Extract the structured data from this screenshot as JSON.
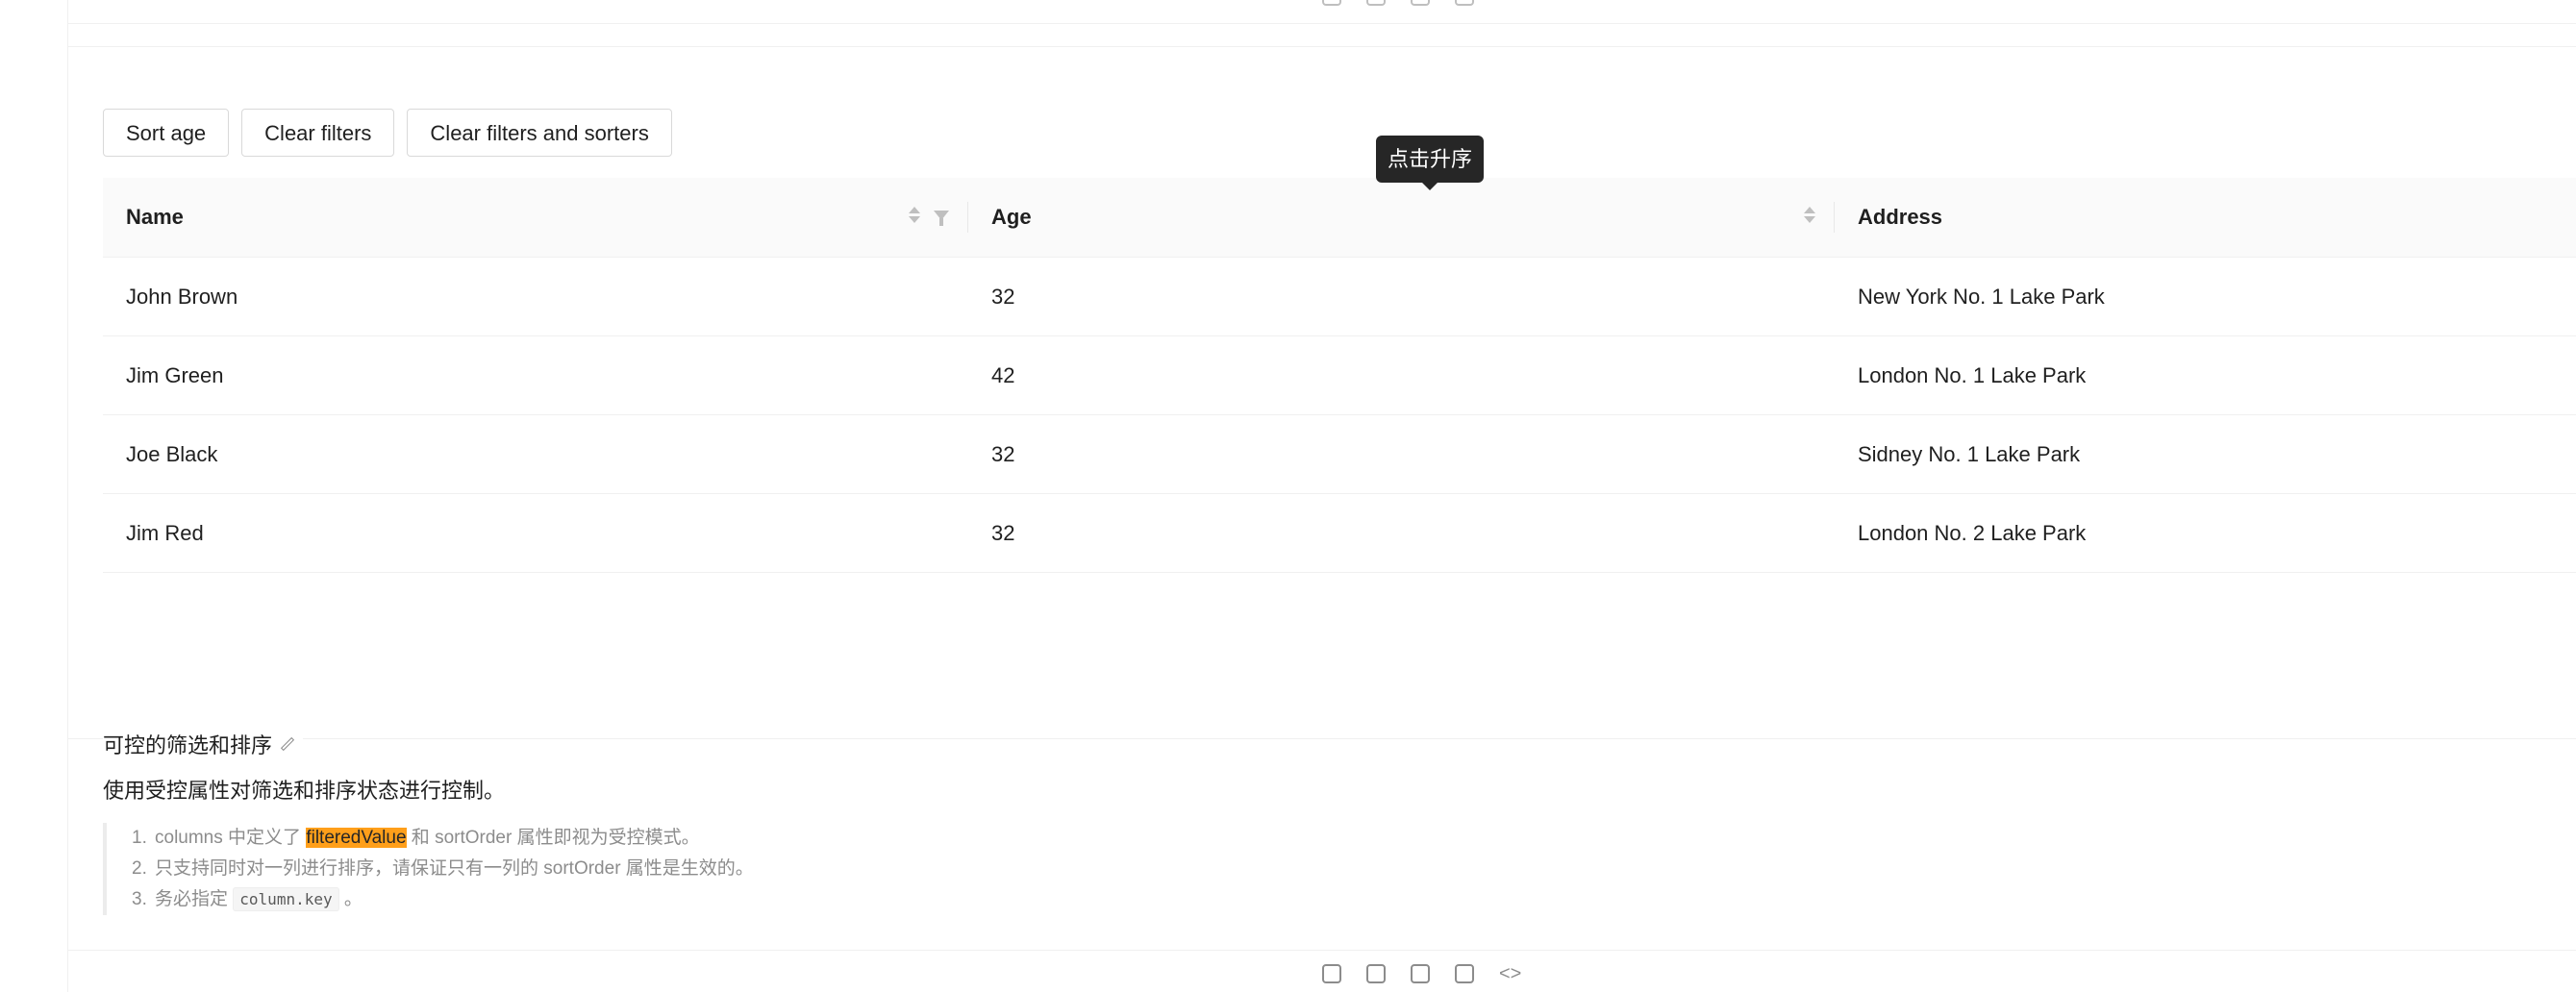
{
  "buttons": {
    "sort_age": "Sort age",
    "clear_filters": "Clear filters",
    "clear_all": "Clear filters and sorters"
  },
  "tooltip": "点击升序",
  "table": {
    "columns": [
      "Name",
      "Age",
      "Address"
    ],
    "rows": [
      {
        "name": "John Brown",
        "age": "32",
        "address": "New York No. 1 Lake Park"
      },
      {
        "name": "Jim Green",
        "age": "42",
        "address": "London No. 1 Lake Park"
      },
      {
        "name": "Joe Black",
        "age": "32",
        "address": "Sidney No. 1 Lake Park"
      },
      {
        "name": "Jim Red",
        "age": "32",
        "address": "London No. 2 Lake Park"
      }
    ]
  },
  "demo": {
    "title": "可控的筛选和排序",
    "description": "使用受控属性对筛选和排序状态进行控制。",
    "notes": [
      {
        "num": "1.",
        "before": "columns 中定义了 ",
        "highlight": "filteredValue",
        "after": " 和 sortOrder 属性即视为受控模式。"
      },
      {
        "num": "2.",
        "text": "只支持同时对一列进行排序，请保证只有一列的 sortOrder 属性是生效的。"
      },
      {
        "num": "3.",
        "before": "务必指定 ",
        "code": "column.key",
        "after": " 。"
      }
    ]
  },
  "toolbar_icons": [
    "codesandbox-icon",
    "codepen-icon",
    "stackblitz-icon",
    "copy-icon",
    "code-expand-icon"
  ],
  "colors": {
    "highlight": "#ff9f1a",
    "tooltip_bg": "#262626",
    "header_bg": "#fafafa"
  }
}
